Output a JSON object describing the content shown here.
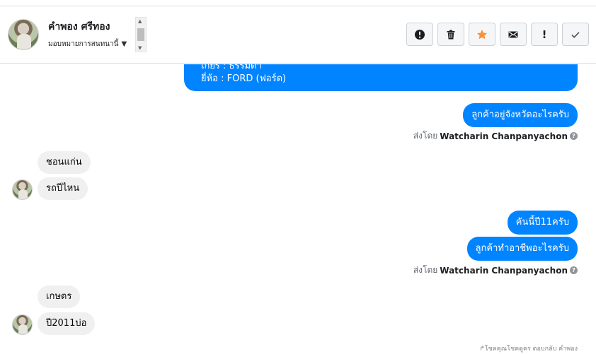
{
  "header": {
    "contact_name": "คำพอง ศรีทอง",
    "assign_label": "มอบหมายการสนทนานี้"
  },
  "toolbar": {
    "buttons": [
      {
        "name": "spam",
        "icon": "alert-circle-icon"
      },
      {
        "name": "delete",
        "icon": "trash-icon"
      },
      {
        "name": "star",
        "icon": "star-icon"
      },
      {
        "name": "unread",
        "icon": "envelope-icon"
      },
      {
        "name": "follow-up",
        "icon": "exclamation-icon",
        "label": "!"
      },
      {
        "name": "done",
        "icon": "checkmark-icon"
      }
    ]
  },
  "messages": {
    "top_line1": "เกียร์ : ธรรมดา",
    "top_line2": "ยี่ห้อ : FORD (ฟอร์ด)",
    "out1": "ลูกค้าอยู่จังหวัดอะไรครับ",
    "sentby_prefix": "ส่งโดย",
    "sentby_name": "Watcharin Chanpanyachon",
    "in1": "ชอนแก่น",
    "in2": "รถปีไหน",
    "out2": "คันนี้ปี11ครับ",
    "out3": "ลูกค้าทำอาชีพอะไรครับ",
    "in3": "เกษตร",
    "in4": "ปี2011บ่อ",
    "footer_note": "↱โชคคุณโชคดูคร ตอบกลับ คำพอง"
  },
  "colors": {
    "accent": "#0084ff",
    "incoming_bg": "#f0f0f0",
    "star": "#f7923b"
  }
}
